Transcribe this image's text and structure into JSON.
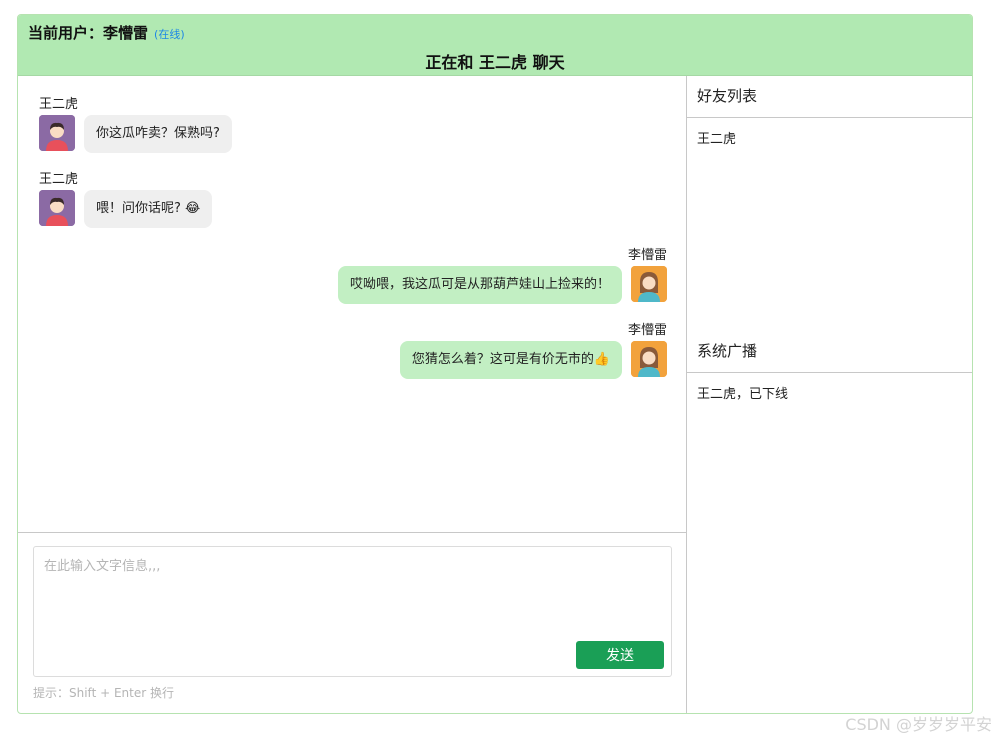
{
  "header": {
    "current_user_label": "当前用户：",
    "current_user_name": "李懵雷",
    "status": "(在线)",
    "chat_title_prefix": "正在和",
    "chat_partner": "王二虎",
    "chat_title_suffix": "聊天"
  },
  "messages": [
    {
      "sender": "王二虎",
      "text": "你这瓜咋卖？保熟吗?",
      "side": "left",
      "avatar": "male-avatar-icon"
    },
    {
      "sender": "王二虎",
      "text": "喂！问你话呢? 😂",
      "side": "left",
      "avatar": "male-avatar-icon"
    },
    {
      "sender": "李懵雷",
      "text": "哎呦喂，我这瓜可是从那葫芦娃山上捡来的！",
      "side": "right",
      "avatar": "female-avatar-icon"
    },
    {
      "sender": "李懵雷",
      "text": "您猜怎么着？这可是有价无市的👍",
      "side": "right",
      "avatar": "female-avatar-icon"
    }
  ],
  "input": {
    "placeholder": "在此输入文字信息,,,",
    "value": "",
    "send_label": "发送",
    "hint": "提示：Shift + Enter 换行"
  },
  "friends": {
    "title": "好友列表",
    "items": [
      "王二虎"
    ]
  },
  "broadcast": {
    "title": "系统广播",
    "items": [
      "王二虎，已下线"
    ]
  },
  "watermark": "CSDN @岁岁岁平安",
  "colors": {
    "header_bg": "#b1e9b2",
    "own_bubble": "#c2efc3",
    "other_bubble": "#efefef",
    "send_button": "#1a9f56",
    "status": "#1e88e5"
  }
}
